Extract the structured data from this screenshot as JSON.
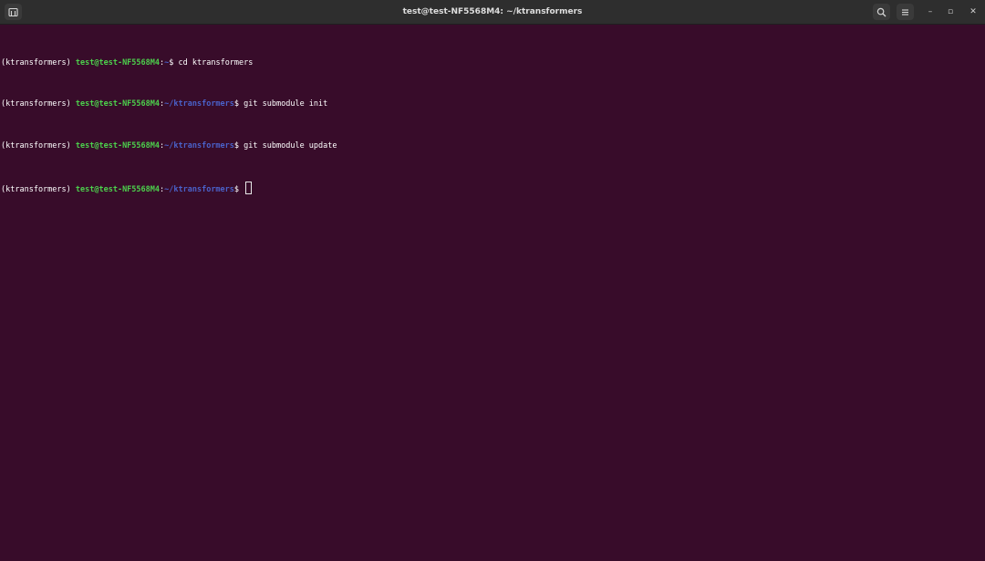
{
  "window": {
    "title": "test@test-NF5568M4: ~/ktransformers"
  },
  "titlebar": {
    "new_tab_icon": "new-tab-icon",
    "search_icon": "search-icon",
    "menu_icon": "hamburger-menu-icon",
    "minimize_glyph": "–",
    "maximize_glyph": "▫",
    "close_glyph": "✕"
  },
  "colors": {
    "background": "#380c2a",
    "host": "#4cd04c",
    "path": "#4a61c9",
    "text": "#ffffff"
  },
  "terminal": {
    "lines": [
      {
        "env": "(ktransformers) ",
        "host": "test@test-NF5568M4",
        "colon": ":",
        "path": "~",
        "prompt": "$ ",
        "command": "cd ktransformers"
      },
      {
        "env": "(ktransformers) ",
        "host": "test@test-NF5568M4",
        "colon": ":",
        "path": "~/ktransformers",
        "prompt": "$ ",
        "command": "git submodule init"
      },
      {
        "env": "(ktransformers) ",
        "host": "test@test-NF5568M4",
        "colon": ":",
        "path": "~/ktransformers",
        "prompt": "$ ",
        "command": "git submodule update"
      },
      {
        "env": "(ktransformers) ",
        "host": "test@test-NF5568M4",
        "colon": ":",
        "path": "~/ktransformers",
        "prompt": "$ ",
        "command": ""
      }
    ]
  }
}
